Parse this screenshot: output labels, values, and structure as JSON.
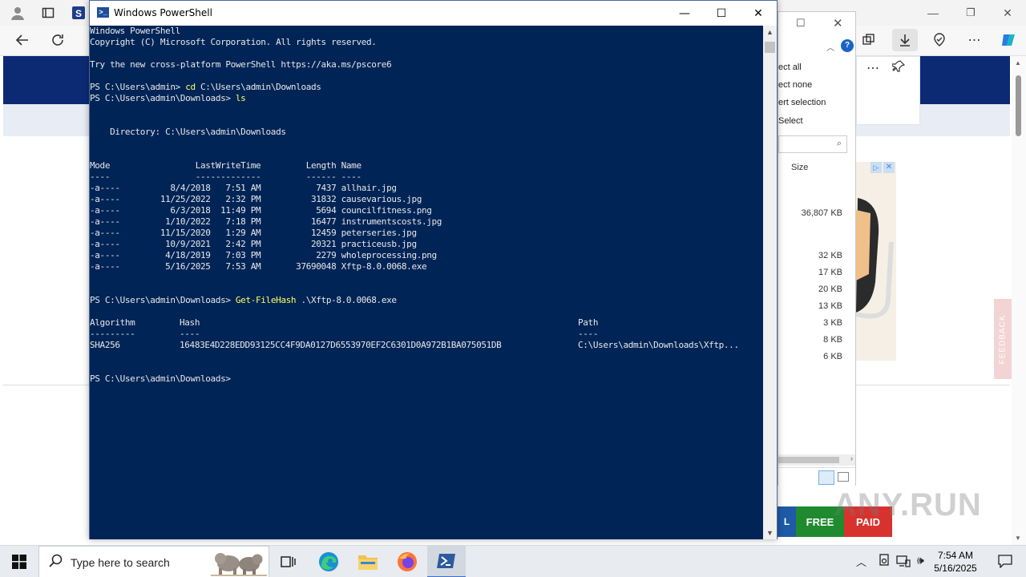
{
  "powershell": {
    "title": "Windows PowerShell",
    "controls": {
      "minimize": "—",
      "maximize": "☐",
      "close": "✕"
    },
    "lines": [
      {
        "type": "text",
        "text": "Windows PowerShell"
      },
      {
        "type": "text",
        "text": "Copyright (C) Microsoft Corporation. All rights reserved."
      },
      {
        "type": "blank"
      },
      {
        "type": "text",
        "text": "Try the new cross-platform PowerShell https://aka.ms/pscore6"
      },
      {
        "type": "blank"
      },
      {
        "type": "cmd",
        "prompt": "PS C:\\Users\\admin> ",
        "cmd": "cd",
        "args": " C:\\Users\\admin\\Downloads"
      },
      {
        "type": "cmd",
        "prompt": "PS C:\\Users\\admin\\Downloads> ",
        "cmd": "ls",
        "args": ""
      },
      {
        "type": "blank"
      },
      {
        "type": "blank"
      },
      {
        "type": "text",
        "text": "    Directory: C:\\Users\\admin\\Downloads"
      },
      {
        "type": "blank"
      },
      {
        "type": "blank"
      },
      {
        "type": "text",
        "text": "Mode                 LastWriteTime         Length Name"
      },
      {
        "type": "text",
        "text": "----                 -------------         ------ ----"
      },
      {
        "type": "text",
        "text": "-a----          8/4/2018   7:51 AM           7437 allhair.jpg"
      },
      {
        "type": "text",
        "text": "-a----        11/25/2022   2:32 PM          31832 causevarious.jpg"
      },
      {
        "type": "text",
        "text": "-a----          6/3/2018  11:49 PM           5694 councilfitness.png"
      },
      {
        "type": "text",
        "text": "-a----         1/10/2022   7:18 PM          16477 instrumentscosts.jpg"
      },
      {
        "type": "text",
        "text": "-a----        11/15/2020   1:29 AM          12459 peterseries.jpg"
      },
      {
        "type": "text",
        "text": "-a----         10/9/2021   2:42 PM          20321 practiceusb.jpg"
      },
      {
        "type": "text",
        "text": "-a----         4/18/2019   7:03 PM           2279 wholeprocessing.png"
      },
      {
        "type": "text",
        "text": "-a----         5/16/2025   7:53 AM       37690048 Xftp-8.0.0068.exe"
      },
      {
        "type": "blank"
      },
      {
        "type": "blank"
      },
      {
        "type": "cmd",
        "prompt": "PS C:\\Users\\admin\\Downloads> ",
        "cmd": "Get-FileHash",
        "args": " .\\Xftp-8.0.0068.exe"
      },
      {
        "type": "blank"
      },
      {
        "type": "hash",
        "c1": "Algorithm",
        "c2": "Hash",
        "c3": "Path"
      },
      {
        "type": "hash",
        "c1": "---------",
        "c2": "----",
        "c3": "----"
      },
      {
        "type": "hash",
        "c1": "SHA256",
        "c2": "16483E4D228EDD93125CC4F9DA0127D6553970EF2C6301D0A972B1BA075051DB",
        "c3": "C:\\Users\\admin\\Downloads\\Xftp..."
      },
      {
        "type": "blank"
      },
      {
        "type": "blank"
      },
      {
        "type": "text",
        "text": "PS C:\\Users\\admin\\Downloads>"
      }
    ]
  },
  "explorer": {
    "ribbon": [
      "ect all",
      "ect none",
      "ert selection",
      "Select"
    ],
    "size_header": "Size",
    "sizes": [
      "36,807 KB",
      "32 KB",
      "17 KB",
      "20 KB",
      "13 KB",
      "3 KB",
      "8 KB",
      "6 KB"
    ]
  },
  "browser_page": {
    "feedback": "FEEDBACK",
    "free_label": "FREE",
    "paid_label": "PAID",
    "edge_l": "L",
    "watermark": "ANY.RUN"
  },
  "taskbar": {
    "search_placeholder": "Type here to search",
    "time": "7:54 AM",
    "date": "5/16/2025"
  },
  "colors": {
    "console_bg": "#012456",
    "console_fg": "#e8e8e8",
    "command": "#ffff5f",
    "banner": "#0c2a74"
  }
}
